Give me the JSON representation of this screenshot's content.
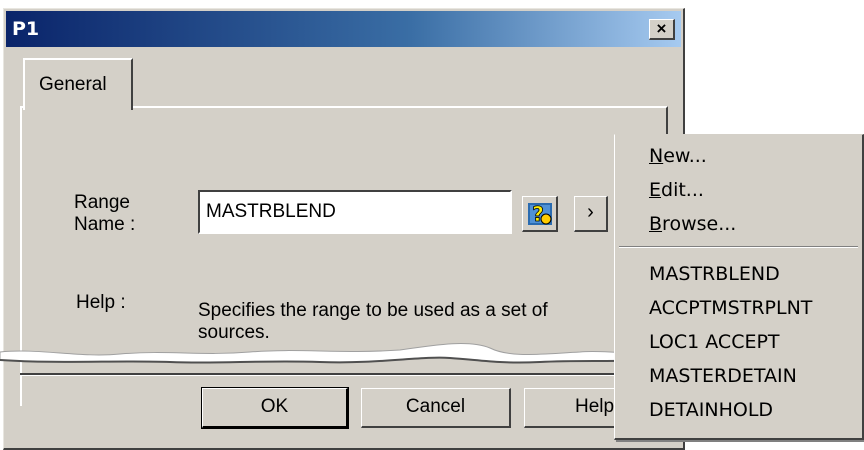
{
  "window": {
    "title": "P1",
    "close_symbol": "×"
  },
  "tabs": [
    {
      "label": "General"
    }
  ],
  "form": {
    "range_label_line1": "Range",
    "range_label_line2": "Name :",
    "range_value": "MASTRBLEND",
    "help_label": "Help :",
    "help_text_line1": "Specifies the range to be used as a set of",
    "help_text_line2": "sources."
  },
  "buttons": {
    "ok": "OK",
    "cancel": "Cancel",
    "help": "Help"
  },
  "icons": {
    "browse_help": "question-icon",
    "arrow": "chevron-right-icon"
  },
  "arrow_glyph": "›",
  "context_menu": {
    "actions": [
      {
        "accel": "N",
        "rest": "ew..."
      },
      {
        "accel": "E",
        "rest": "dit..."
      },
      {
        "accel": "B",
        "rest": "rowse..."
      }
    ],
    "ranges": [
      "MASTRBLEND",
      "ACCPTMSTRPLNT",
      "LOC1 ACCEPT",
      "MASTERDETAIN",
      "DETAINHOLD"
    ]
  },
  "colors": {
    "title_start": "#0a246a",
    "title_end": "#a6caf0",
    "face": "#d4d0c8"
  }
}
